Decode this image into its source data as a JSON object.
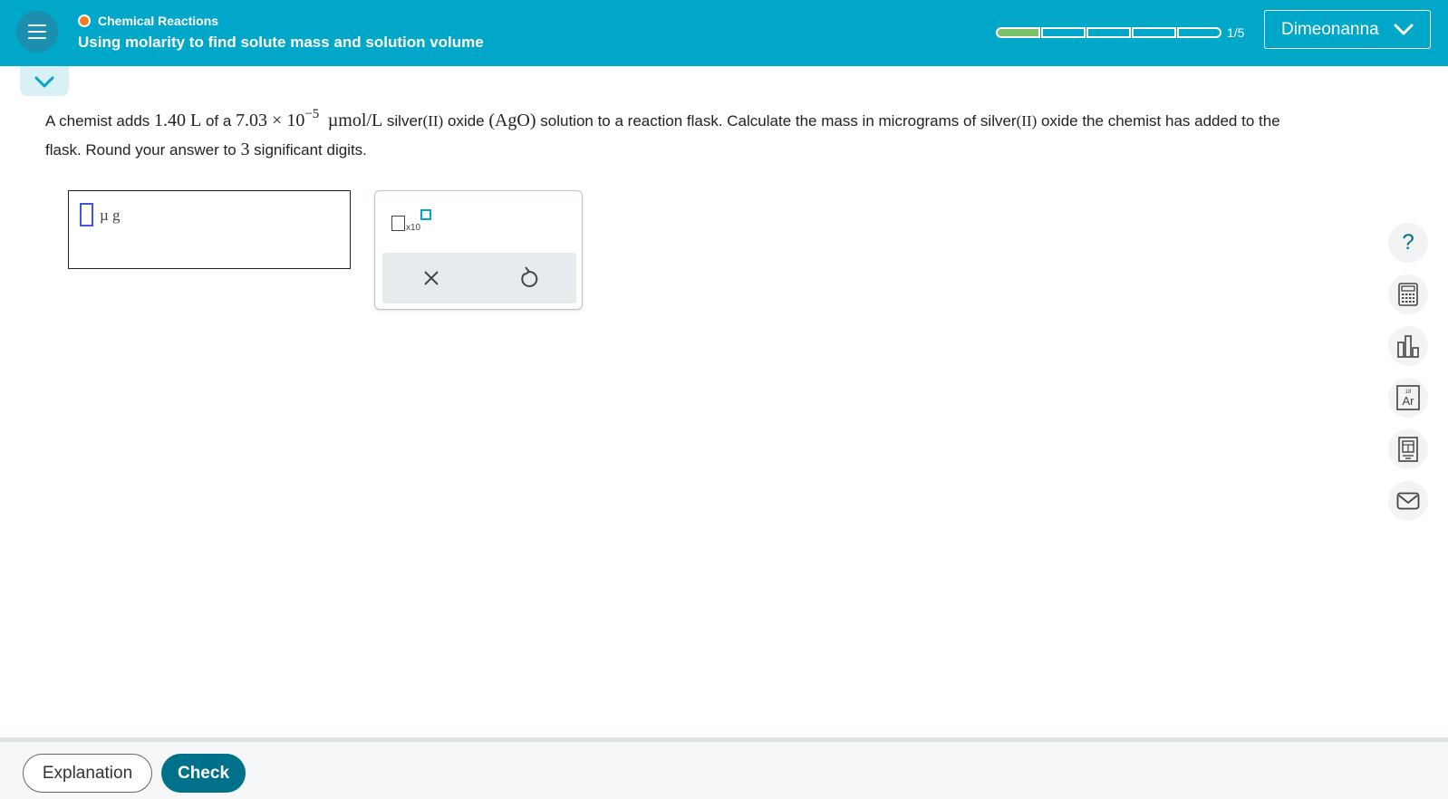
{
  "header": {
    "topic": "Chemical Reactions",
    "lesson_title": "Using molarity to find solute mass and solution volume",
    "progress_count": "1/5",
    "user_name": "Dimeonanna",
    "topic_status_color": "#f47c20",
    "accent_color": "#00a7c8"
  },
  "progress": {
    "completed": 1,
    "total": 5
  },
  "question": {
    "t1": "A chemist adds ",
    "v_volume": "1.40 L",
    "t2": " of a ",
    "v_conc": "7.03 × 10",
    "v_exp": "−5",
    "v_unit": "µmol/L",
    "t3": " silver",
    "v_ox1": "(II)",
    "t4": " oxide ",
    "v_formula": "(AgO)",
    "t5": " solution to a reaction flask. Calculate the mass in micrograms of silver",
    "v_ox2": "(II)",
    "t6": " oxide the chemist has added to the flask. Round your answer to ",
    "v_digits": "3",
    "t7": " significant digits."
  },
  "answer": {
    "unit": "µ g",
    "value": ""
  },
  "keypad": {
    "x10_label": "x10"
  },
  "tools": [
    "help-icon",
    "calculator-icon",
    "chart-icon",
    "periodic-table-icon",
    "reference-icon",
    "mail-icon"
  ],
  "tool_labels": {
    "help": "?",
    "periodic_symbol": "Ar",
    "periodic_number": "18"
  },
  "footer": {
    "explanation_label": "Explanation",
    "check_label": "Check"
  }
}
